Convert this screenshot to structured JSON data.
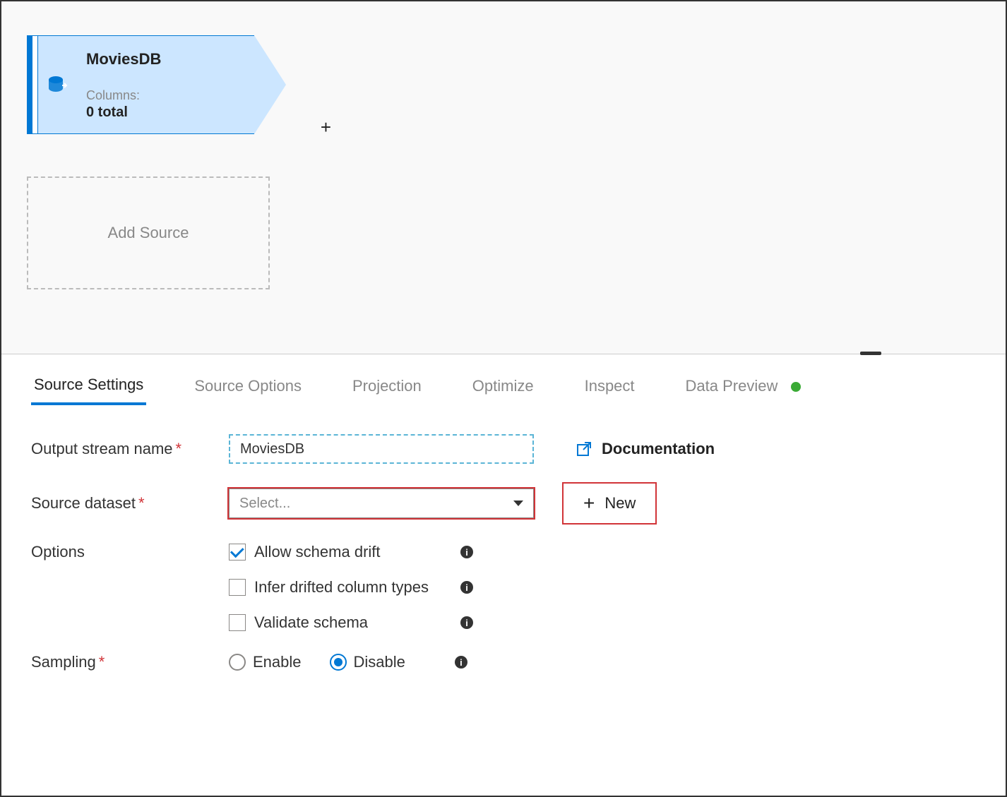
{
  "node": {
    "title": "MoviesDB",
    "columns_label": "Columns:",
    "columns_count": "0 total"
  },
  "add_source_label": "Add Source",
  "tabs": {
    "source_settings": "Source Settings",
    "source_options": "Source Options",
    "projection": "Projection",
    "optimize": "Optimize",
    "inspect": "Inspect",
    "data_preview": "Data Preview"
  },
  "form": {
    "output_stream_label": "Output stream name",
    "output_stream_value": "MoviesDB",
    "source_dataset_label": "Source dataset",
    "source_dataset_placeholder": "Select...",
    "documentation_label": "Documentation",
    "new_label": "New",
    "options_label": "Options",
    "allow_schema_drift": "Allow schema drift",
    "infer_drifted": "Infer drifted column types",
    "validate_schema": "Validate schema",
    "sampling_label": "Sampling",
    "enable": "Enable",
    "disable": "Disable"
  }
}
